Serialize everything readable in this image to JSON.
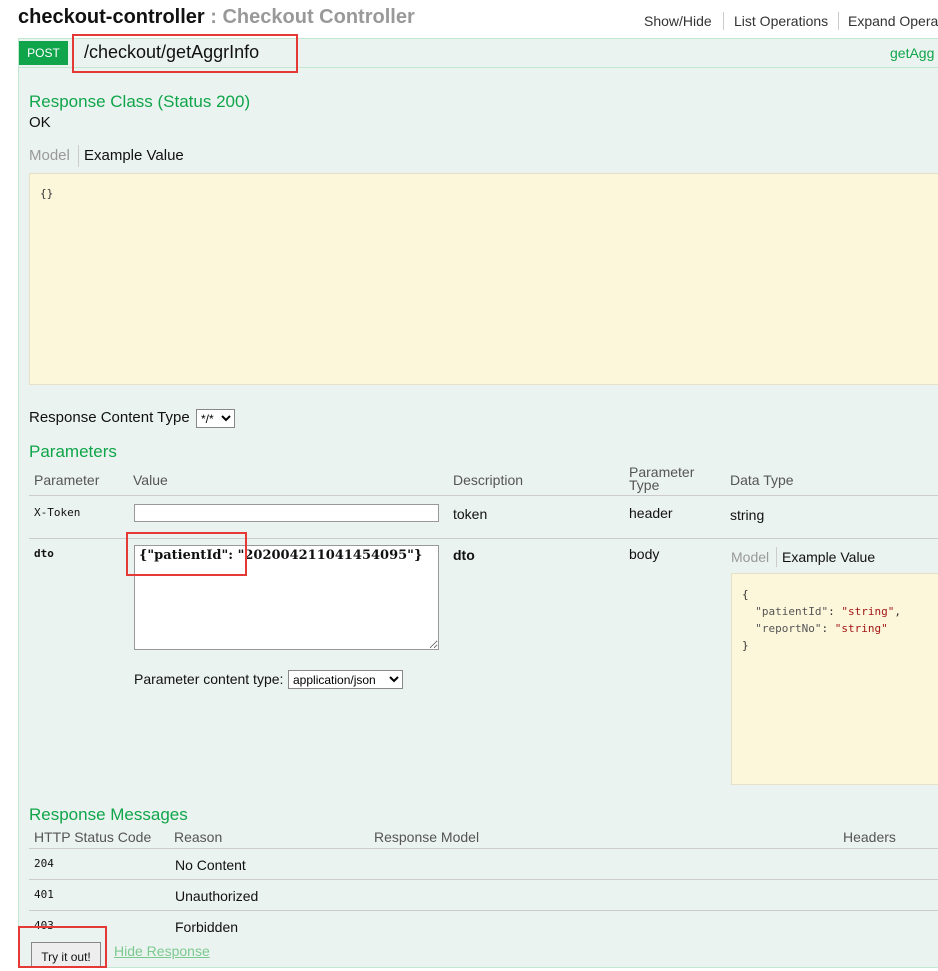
{
  "controller": {
    "name": "checkout-controller",
    "separator": " : ",
    "description": "Checkout Controller",
    "links": [
      "Show/Hide",
      "List Operations",
      "Expand Operat"
    ]
  },
  "operation": {
    "method": "POST",
    "path": "/checkout/getAggrInfo",
    "nickname": "getAgg"
  },
  "response_class": {
    "title": "Response Class (Status 200)",
    "status_text": "OK",
    "tab_model": "Model",
    "tab_example": "Example Value",
    "example_value": "{}"
  },
  "response_content_type": {
    "label": "Response Content Type",
    "selected": "*/*"
  },
  "parameters": {
    "title": "Parameters",
    "headers": {
      "parameter": "Parameter",
      "value": "Value",
      "description": "Description",
      "param_type_line1": "Parameter",
      "param_type_line2": "Type",
      "data_type": "Data Type"
    },
    "rows": [
      {
        "name": "X-Token",
        "value": "",
        "description": "token",
        "param_type": "header",
        "data_type": "string"
      },
      {
        "name": "dto",
        "value": "{\"patientId\": \"202004211041454095\"}",
        "description": "dto",
        "param_type": "body"
      }
    ],
    "dto_data_type": {
      "tab_model": "Model",
      "tab_example": "Example Value",
      "json_open": "{",
      "key1": "\"patientId\"",
      "val1": "\"string\"",
      "key2": "\"reportNo\"",
      "val2": "\"string\"",
      "json_close": "}"
    },
    "content_type_label": "Parameter content type:",
    "content_type_selected": "application/json"
  },
  "response_messages": {
    "title": "Response Messages",
    "headers": {
      "status": "HTTP Status Code",
      "reason": "Reason",
      "model": "Response Model",
      "headers": "Headers"
    },
    "rows": [
      {
        "code": "204",
        "reason": "No Content"
      },
      {
        "code": "401",
        "reason": "Unauthorized"
      },
      {
        "code": "403",
        "reason": "Forbidden"
      }
    ]
  },
  "actions": {
    "try_it_out": "Try it out!",
    "hide_response": "Hide Response"
  },
  "colors": {
    "post_green": "#10a54a",
    "panel_bg": "#ebf3f0",
    "snippet_bg": "#fcf6db",
    "highlight_red": "#e53935"
  }
}
